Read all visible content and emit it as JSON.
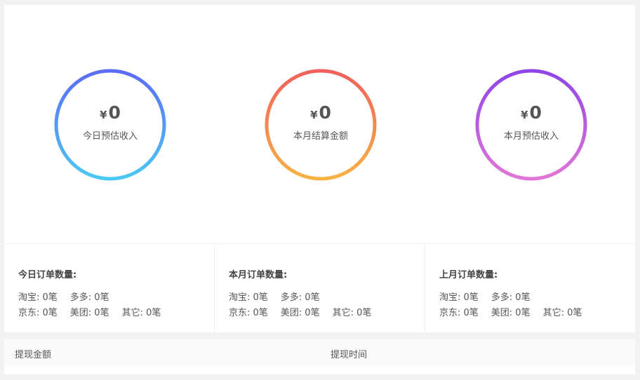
{
  "summary": [
    {
      "currency": "¥",
      "amount": "0",
      "label": "今日预估收入",
      "gradient": [
        "#5b6cf5",
        "#4cc8f4"
      ]
    },
    {
      "currency": "¥",
      "amount": "0",
      "label": "本月结算金额",
      "gradient": [
        "#f0605d",
        "#f7b245"
      ]
    },
    {
      "currency": "¥",
      "amount": "0",
      "label": "本月预估收入",
      "gradient": [
        "#9044e6",
        "#e276d6"
      ]
    }
  ],
  "orders": [
    {
      "title": "今日订单数量:",
      "line1": [
        "淘宝: 0笔",
        "多多: 0笔"
      ],
      "line2": [
        "京东: 0笔",
        "美团: 0笔",
        "其它: 0笔"
      ]
    },
    {
      "title": "本月订单数量:",
      "line1": [
        "淘宝: 0笔",
        "多多: 0笔"
      ],
      "line2": [
        "京东: 0笔",
        "美团: 0笔",
        "其它: 0笔"
      ]
    },
    {
      "title": "上月订单数量:",
      "line1": [
        "淘宝: 0笔",
        "多多: 0笔"
      ],
      "line2": [
        "京东: 0笔",
        "美团: 0笔",
        "其它: 0笔"
      ]
    }
  ],
  "withdraw_table": {
    "columns": [
      "提现金额",
      "提现时间"
    ]
  }
}
